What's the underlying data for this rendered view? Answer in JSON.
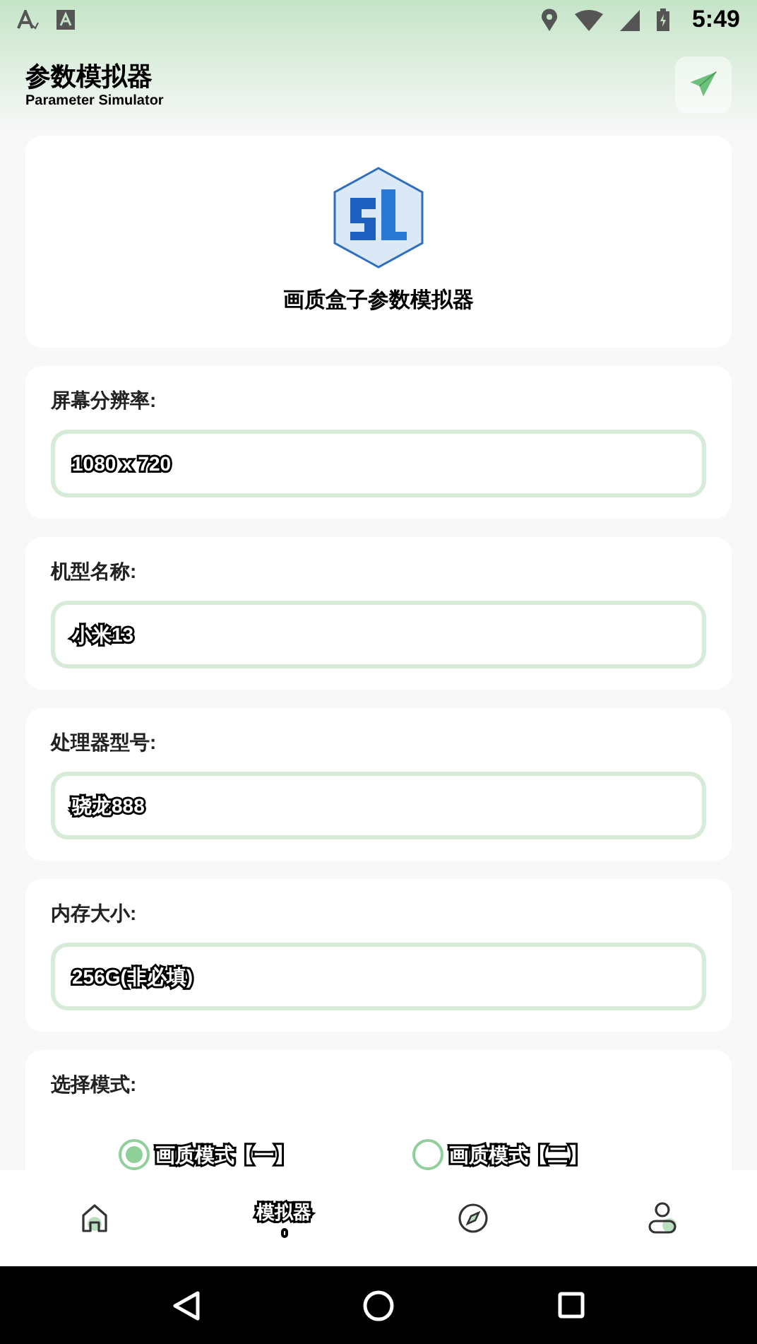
{
  "status_bar": {
    "time": "5:49"
  },
  "header": {
    "title": "参数模拟器",
    "subtitle": "Parameter Simulator"
  },
  "logo_card": {
    "caption": "画质盒子参数模拟器"
  },
  "fields": [
    {
      "label": "屏幕分辨率:",
      "value": "1080 x 720"
    },
    {
      "label": "机型名称:",
      "value": "小米13"
    },
    {
      "label": "处理器型号:",
      "value": "骁龙888"
    },
    {
      "label": "内存大小:",
      "value": "256G(非必填)"
    }
  ],
  "mode": {
    "label": "选择模式:",
    "options": [
      {
        "label": "画质模式【一】",
        "selected": true
      },
      {
        "label": "画质模式【二】",
        "selected": false
      }
    ]
  },
  "tabs": [
    {
      "kind": "home",
      "selected": false
    },
    {
      "label": "模拟器",
      "selected": true
    },
    {
      "kind": "compass",
      "selected": false
    },
    {
      "kind": "profile",
      "selected": false
    }
  ]
}
